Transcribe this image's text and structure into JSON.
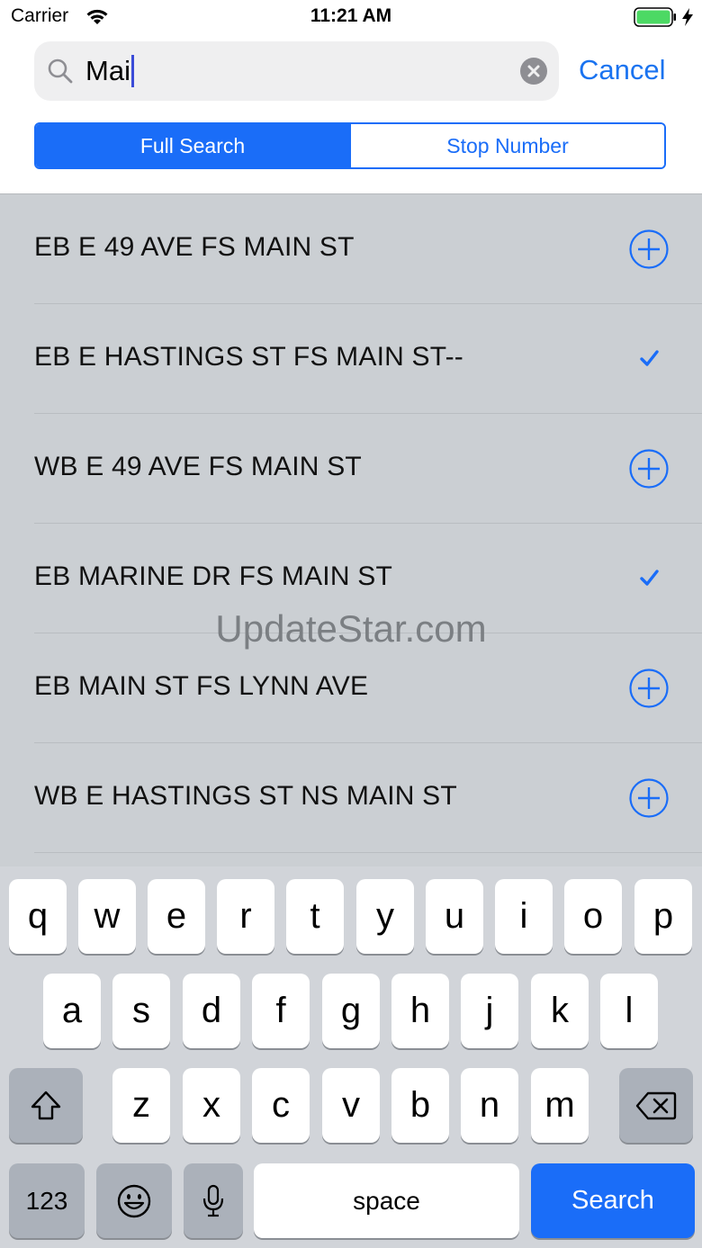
{
  "status_bar": {
    "carrier": "Carrier",
    "time": "11:21 AM"
  },
  "search": {
    "query": "Mai",
    "cancel_label": "Cancel"
  },
  "segments": {
    "full_search": "Full Search",
    "stop_number": "Stop Number",
    "selected": "full_search"
  },
  "results": [
    {
      "label": "EB E 49 AVE FS MAIN ST",
      "action": "add-circle-icon"
    },
    {
      "label": "EB E HASTINGS ST FS MAIN ST--",
      "action": "checkmark-icon"
    },
    {
      "label": "WB E 49 AVE FS MAIN ST",
      "action": "add-circle-icon"
    },
    {
      "label": "EB MARINE DR FS MAIN ST",
      "action": "checkmark-icon"
    },
    {
      "label": "EB MAIN ST FS LYNN AVE",
      "action": "add-circle-icon"
    },
    {
      "label": "WB E HASTINGS ST NS MAIN ST",
      "action": "add-circle-icon"
    }
  ],
  "watermark": "UpdateStar.com",
  "keyboard": {
    "row1": [
      "q",
      "w",
      "e",
      "r",
      "t",
      "y",
      "u",
      "i",
      "o",
      "p"
    ],
    "row2": [
      "a",
      "s",
      "d",
      "f",
      "g",
      "h",
      "j",
      "k",
      "l"
    ],
    "row3": [
      "z",
      "x",
      "c",
      "v",
      "b",
      "n",
      "m"
    ],
    "numbers_label": "123",
    "space_label": "space",
    "search_label": "Search"
  },
  "colors": {
    "accent": "#1a6df8",
    "list_bg": "#cbcfd3",
    "keyboard_bg": "#d1d4d9"
  }
}
